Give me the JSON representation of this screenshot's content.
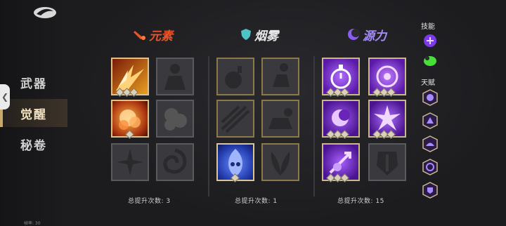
{
  "sidebar": {
    "items": [
      {
        "label": "武器",
        "active": false
      },
      {
        "label": "觉醒",
        "active": true
      },
      {
        "label": "秘卷",
        "active": false
      }
    ],
    "fps_label": "帧率: 30"
  },
  "columns": [
    {
      "title": "元素",
      "icon": "rocket-icon",
      "accent": "#e8542a",
      "stat_text": "总提升次数: 3"
    },
    {
      "title": "烟雾",
      "icon": "shield-icon",
      "accent": "#4fc3c8",
      "stat_text": "总提升次数: 1"
    },
    {
      "title": "源力",
      "icon": "crescent-icon",
      "accent": "#8b5cf6",
      "stat_text": "总提升次数: 15"
    }
  ],
  "right_panel": {
    "skills_label": "技能",
    "talents_label": "天赋"
  },
  "colors": {
    "fire": "#e8542a",
    "smoke_blue": "#3b5bd6",
    "purple": "#7c3aed",
    "gold_border": "#d9c79a"
  }
}
